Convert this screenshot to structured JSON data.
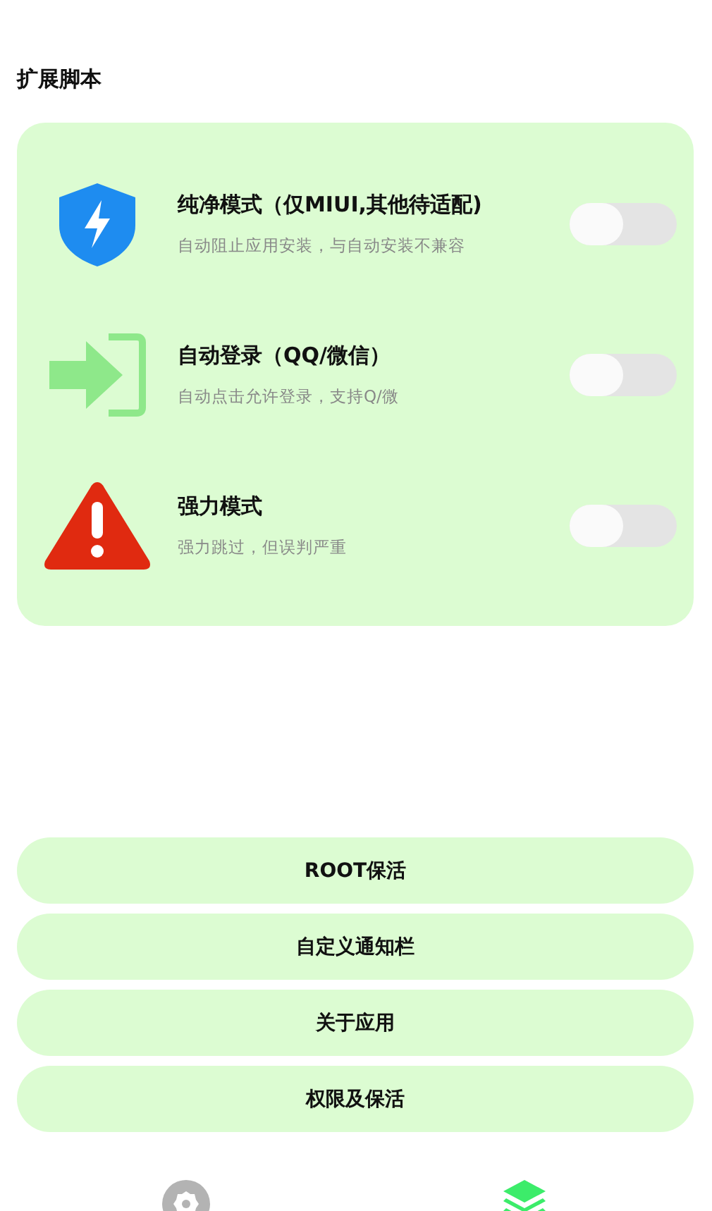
{
  "section_title": "扩展脚本",
  "features": [
    {
      "kind": "shield",
      "title": "纯净模式（仅MIUI,其他待适配)",
      "description": "自动阻止应用安装，与自动安装不兼容",
      "on": false
    },
    {
      "kind": "login",
      "title": "自动登录（QQ/微信）",
      "description": "自动点击允许登录，支持Q/微",
      "on": false
    },
    {
      "kind": "warning",
      "title": "强力模式",
      "description": "强力跳过，但误判严重",
      "on": false
    }
  ],
  "buttons": [
    "ROOT保活",
    "自定义通知栏",
    "关于应用",
    "权限及保活"
  ],
  "nav": [
    {
      "kind": "gear",
      "selected": false
    },
    {
      "kind": "layers",
      "selected": true
    }
  ]
}
